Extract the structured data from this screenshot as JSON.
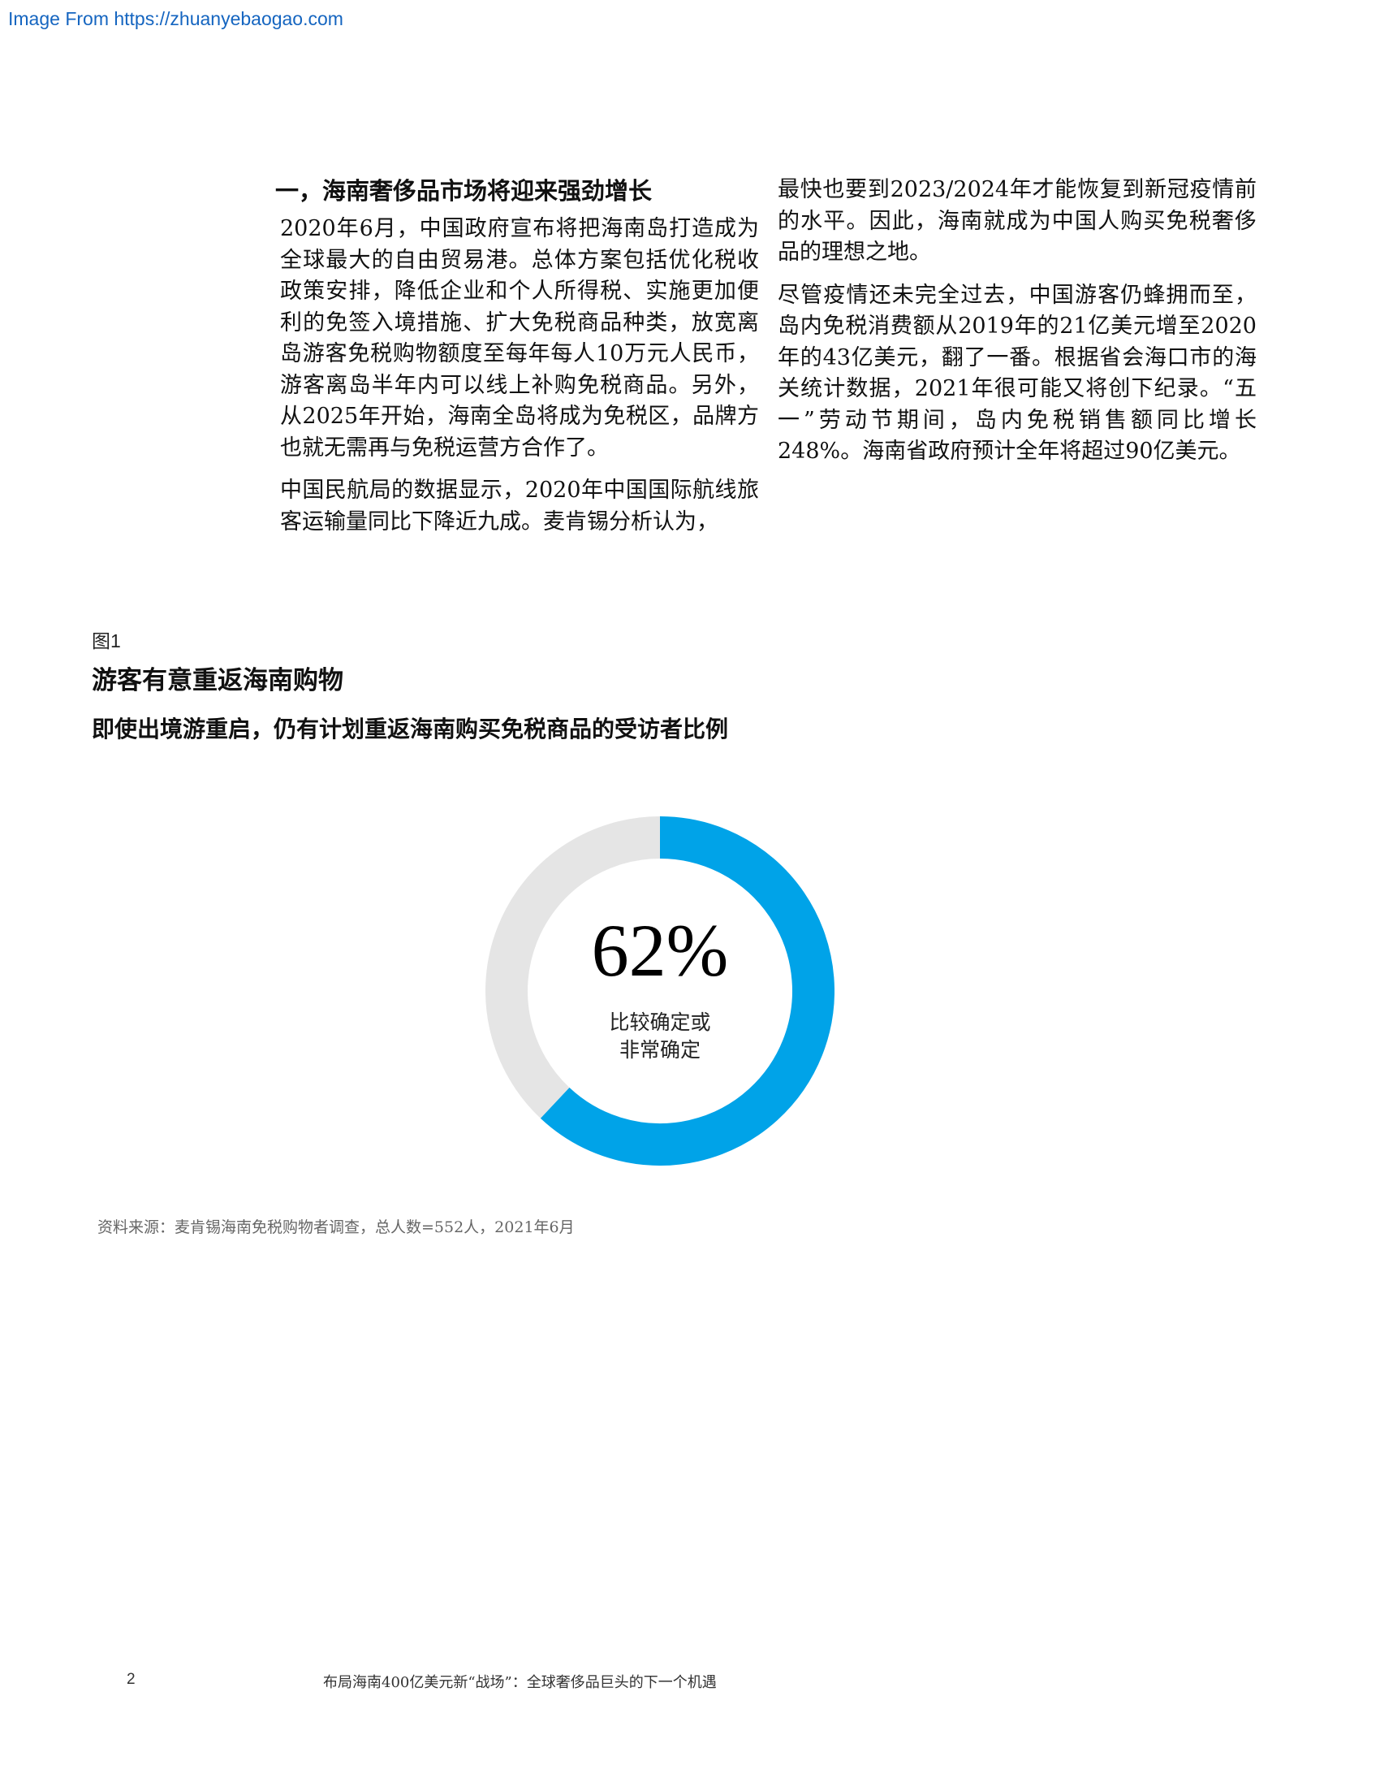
{
  "watermark": "Image From https://zhuanyebaogao.com",
  "section_heading": "一，海南奢侈品市场将迎来强劲增长",
  "left_paragraphs": [
    "2020年6月，中国政府宣布将把海南岛打造成为全球最大的自由贸易港。总体方案包括优化税收政策安排，降低企业和个人所得税、实施更加便利的免签入境措施、扩大免税商品种类，放宽离岛游客免税购物额度至每年每人10万元人民币，游客离岛半年内可以线上补购免税商品。另外，从2025年开始，海南全岛将成为免税区，品牌方也就无需再与免税运营方合作了。",
    "中国民航局的数据显示，2020年中国国际航线旅客运输量同比下降近九成。麦肯锡分析认为，"
  ],
  "right_paragraphs": [
    "最快也要到2023/2024年才能恢复到新冠疫情前的水平。因此，海南就成为中国人购买免税奢侈品的理想之地。",
    "尽管疫情还未完全过去，中国游客仍蜂拥而至，岛内免税消费额从2019年的21亿美元增至2020年的43亿美元，翻了一番。根据省会海口市的海关统计数据，2021年很可能又将创下纪录。“五一”劳动节期间，岛内免税销售额同比增长248%。海南省政府预计全年将超过90亿美元。"
  ],
  "figure": {
    "label": "图1",
    "title": "游客有意重返海南购物",
    "subtitle": "即使出境游重启，仍有计划重返海南购买免税商品的受访者比例",
    "source": "资料来源：麦肯锡海南免税购物者调查，总人数=552人，2021年6月"
  },
  "chart_data": {
    "type": "pie",
    "subtype": "donut",
    "value_label": "62%",
    "center_label_lines": [
      "比较确定或",
      "非常确定"
    ],
    "slices": [
      {
        "value": 62,
        "color": "#00a3e8"
      },
      {
        "value": 38,
        "color": "#e5e5e5"
      }
    ]
  },
  "footer": {
    "page_number": "2",
    "title": "布局海南400亿美元新“战场”：全球奢侈品巨头的下一个机遇"
  }
}
